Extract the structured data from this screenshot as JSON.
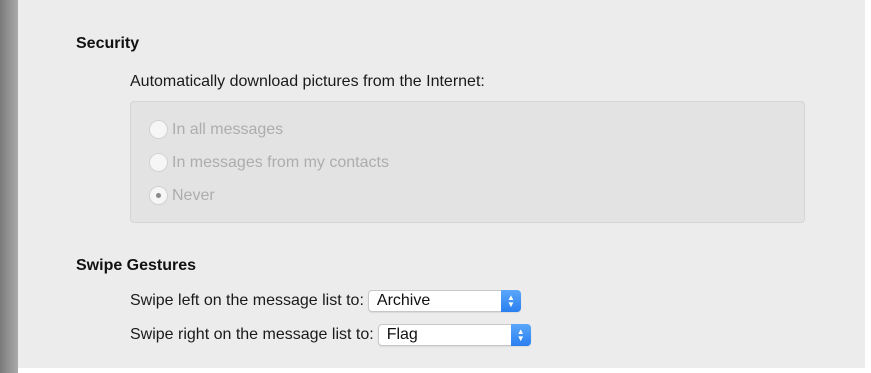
{
  "security": {
    "title": "Security",
    "question": "Automatically download pictures from the Internet:",
    "options": [
      {
        "label": "In all messages",
        "selected": false
      },
      {
        "label": "In messages from my contacts",
        "selected": false
      },
      {
        "label": "Never",
        "selected": true
      }
    ]
  },
  "swipe": {
    "title": "Swipe Gestures",
    "left_label": "Swipe left on the message list to:",
    "left_value": "Archive",
    "right_label": "Swipe right on the message list to:",
    "right_value": "Flag"
  },
  "colors": {
    "pane_background": "#ececec",
    "accent": "#2a7ff0",
    "disabled_text": "#adadad"
  }
}
